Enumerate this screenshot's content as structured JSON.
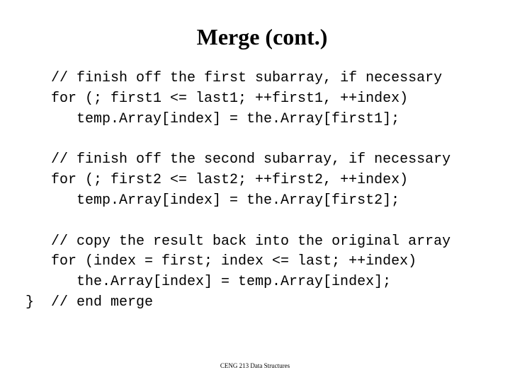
{
  "slide": {
    "title": "Merge (cont.)",
    "code_blocks": [
      {
        "lines": [
          "// finish off the first subarray, if necessary",
          "for (; first1 <= last1; ++first1, ++index)",
          "temp.Array[index] = the.Array[first1];"
        ]
      },
      {
        "lines": [
          "// finish off the second subarray, if necessary",
          "for (; first2 <= last2; ++first2, ++index)",
          "temp.Array[index] = the.Array[first2];"
        ]
      },
      {
        "lines": [
          "// copy the result back into the original array",
          "for (index = first; index <= last; ++index)",
          "the.Array[index] = temp.Array[index];"
        ]
      }
    ],
    "closing_brace": "}",
    "end_comment": "// end merge",
    "footer": "CENG 213 Data Structures"
  }
}
